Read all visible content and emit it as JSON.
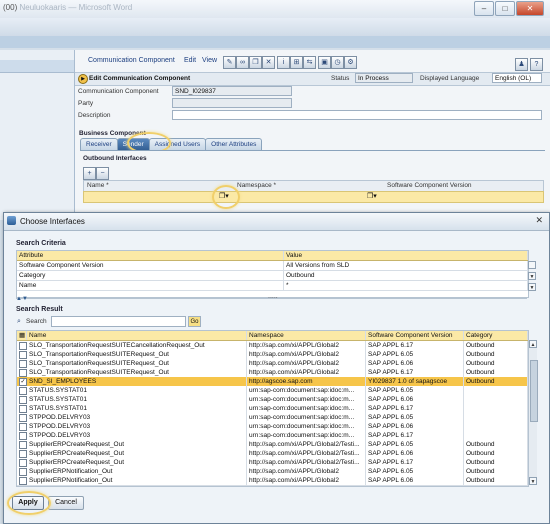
{
  "bg_window": {
    "title": "(00)",
    "title_faded": "Neuluokaaris — Microsoft Word",
    "controls": {
      "minimize": "–",
      "maximize": "□",
      "close": "✕"
    }
  },
  "editor": {
    "menu": {
      "object": "Communication Component",
      "edit": "Edit",
      "view": "View"
    },
    "header": {
      "title": "Edit Communication Component",
      "status_label": "Status",
      "status_value": "In Process",
      "language_label": "Displayed Language",
      "language_value": "English (OL)"
    },
    "fields": {
      "component_label": "Communication Component",
      "component_value": "SND_I029837",
      "party_label": "Party",
      "description_label": "Description"
    },
    "business_component_label": "Business Component",
    "tabs": [
      {
        "label": "Receiver",
        "active": false
      },
      {
        "label": "Sender",
        "active": true
      },
      {
        "label": "Assigned Users",
        "active": false
      },
      {
        "label": "Other Attributes",
        "active": false
      }
    ],
    "outbound": {
      "title": "Outbound Interfaces",
      "columns": {
        "name": "Name *",
        "namespace": "Namespace *",
        "swc": "Software Component Version"
      }
    }
  },
  "dialog": {
    "title": "Choose Interfaces",
    "criteria": {
      "title": "Search Criteria",
      "col_attribute": "Attribute",
      "col_value": "Value",
      "rows": [
        {
          "attribute": "Software Component Version",
          "value": "All Versions from SLD"
        },
        {
          "attribute": "Category",
          "value": "Outbound"
        },
        {
          "attribute": "Name",
          "value": "*"
        }
      ],
      "splitter": "....."
    },
    "result": {
      "title": "Search Result",
      "search_label": "Search",
      "go_label": "Go",
      "columns": {
        "name": "Name",
        "namespace": "Namespace",
        "swc": "Software Component Version",
        "category": "Category"
      },
      "rows": [
        {
          "name": "SLO_TransportationRequestSUITECancellationRequest_Out",
          "namespace": "http://sap.com/xi/APPL/Global2",
          "swc": "SAP APPL 6.17",
          "category": "Outbound",
          "checked": false
        },
        {
          "name": "SLO_TransportationRequestSUITERequest_Out",
          "namespace": "http://sap.com/xi/APPL/Global2",
          "swc": "SAP APPL 6.05",
          "category": "Outbound",
          "checked": false
        },
        {
          "name": "SLO_TransportationRequestSUITERequest_Out",
          "namespace": "http://sap.com/xi/APPL/Global2",
          "swc": "SAP APPL 6.06",
          "category": "Outbound",
          "checked": false
        },
        {
          "name": "SLO_TransportationRequestSUITERequest_Out",
          "namespace": "http://sap.com/xi/APPL/Global2",
          "swc": "SAP APPL 6.17",
          "category": "Outbound",
          "checked": false
        },
        {
          "name": "SND_SI_EMPLOYEES",
          "namespace": "http://agscoe.sap.com",
          "swc": "YI029837 1.0 of sapagscoe",
          "category": "Outbound",
          "checked": true,
          "selected": true
        },
        {
          "name": "STATUS.SYSTAT01",
          "namespace": "urn:sap-com:document:sap:idoc:m...",
          "swc": "SAP APPL 6.05",
          "category": "",
          "checked": false
        },
        {
          "name": "STATUS.SYSTAT01",
          "namespace": "urn:sap-com:document:sap:idoc:m...",
          "swc": "SAP APPL 6.06",
          "category": "",
          "checked": false
        },
        {
          "name": "STATUS.SYSTAT01",
          "namespace": "urn:sap-com:document:sap:idoc:m...",
          "swc": "SAP APPL 6.17",
          "category": "",
          "checked": false
        },
        {
          "name": "STPPOD.DELVRY03",
          "namespace": "urn:sap-com:document:sap:idoc:m...",
          "swc": "SAP APPL 6.05",
          "category": "",
          "checked": false
        },
        {
          "name": "STPPOD.DELVRY03",
          "namespace": "urn:sap-com:document:sap:idoc:m...",
          "swc": "SAP APPL 6.06",
          "category": "",
          "checked": false
        },
        {
          "name": "STPPOD.DELVRY03",
          "namespace": "urn:sap-com:document:sap:idoc:m...",
          "swc": "SAP APPL 6.17",
          "category": "",
          "checked": false
        },
        {
          "name": "SupplierERPCreateRequest_Out",
          "namespace": "http://sap.com/xi/APPL/Global2/Testi...",
          "swc": "SAP APPL 6.05",
          "category": "Outbound",
          "checked": false
        },
        {
          "name": "SupplierERPCreateRequest_Out",
          "namespace": "http://sap.com/xi/APPL/Global2/Testi...",
          "swc": "SAP APPL 6.06",
          "category": "Outbound",
          "checked": false
        },
        {
          "name": "SupplierERPCreateRequest_Out",
          "namespace": "http://sap.com/xi/APPL/Global2/Testi...",
          "swc": "SAP APPL 6.17",
          "category": "Outbound",
          "checked": false
        },
        {
          "name": "SupplierERPNotification_Out",
          "namespace": "http://sap.com/xi/APPL/Global2",
          "swc": "SAP APPL 6.05",
          "category": "Outbound",
          "checked": false
        },
        {
          "name": "SupplierERPNotification_Out",
          "namespace": "http://sap.com/xi/APPL/Global2",
          "swc": "SAP APPL 6.06",
          "category": "Outbound",
          "checked": false
        }
      ]
    },
    "buttons": {
      "apply": "Apply",
      "cancel": "Cancel"
    }
  }
}
